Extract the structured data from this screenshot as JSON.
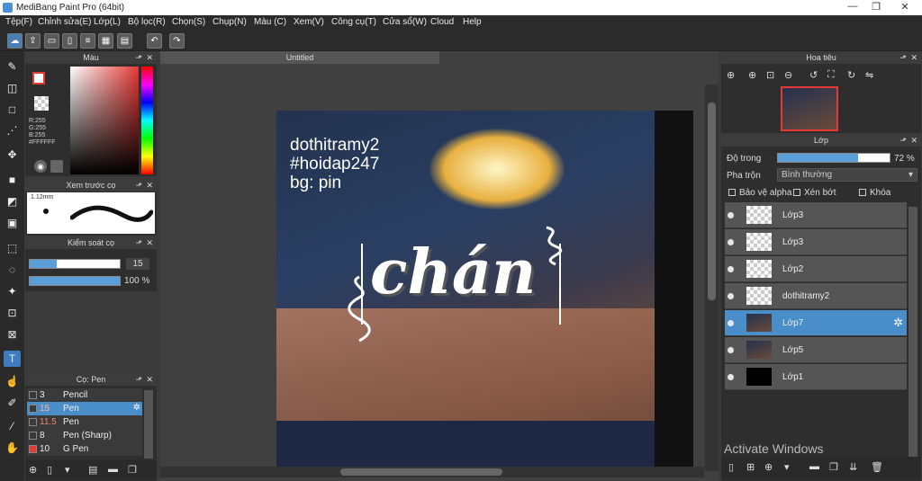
{
  "window": {
    "title": "MediBang Paint Pro (64bit)",
    "min": "—",
    "max": "❐",
    "close": "✕"
  },
  "menu": [
    "Tệp(F)",
    "Chỉnh sửa(E)",
    "Lớp(L)",
    "Bộ lọc(R)",
    "Chọn(S)",
    "Chụp(N)",
    "Màu (C)",
    "Xem(V)",
    "Công cụ(T)",
    "Cửa sổ(W)",
    "Cloud",
    "Help"
  ],
  "panels": {
    "color": {
      "title": "Màu",
      "r": "R:255",
      "g": "G:255",
      "b": "B:255",
      "hex": "#FFFFFF"
    },
    "preview": {
      "title": "Xem trước cọ",
      "size": "1.12mm"
    },
    "brush_control": {
      "title": "Kiểm soát cọ",
      "size_value": "15",
      "size_level": 0.3,
      "opacity_value": "100 %",
      "opacity_level": 1.0
    },
    "brush_list": {
      "title": "Cọ: Pen",
      "items": [
        {
          "size": "3",
          "name": "Pencil",
          "color": "#3a3a3a"
        },
        {
          "size": "15",
          "name": "Pen",
          "color": "#3a3a3a",
          "selected": true
        },
        {
          "size": "11.5",
          "name": "Pen",
          "color": "#3a3a3a"
        },
        {
          "size": "8",
          "name": "Pen (Sharp)",
          "color": "#3a3a3a"
        },
        {
          "size": "10",
          "name": "G Pen",
          "color": "#e53935"
        }
      ]
    }
  },
  "canvas": {
    "tab": "Untitled",
    "text1": "dothitramy2",
    "text2": "#hoidap247",
    "text3": "bg: pin",
    "main_text": "chán"
  },
  "navigator": {
    "title": "Hoa tiêu"
  },
  "layers": {
    "title": "Lớp",
    "opacity_label": "Độ trong",
    "opacity_value": "72 %",
    "opacity_level": 0.72,
    "blend_label": "Pha trộn",
    "blend_value": "Bình thường",
    "protect_alpha": "Bảo vệ alpha",
    "clip": "Xén bớt",
    "lock": "Khóa",
    "items": [
      {
        "name": "Lớp3",
        "thumb": "checker"
      },
      {
        "name": "Lớp3",
        "thumb": "checker"
      },
      {
        "name": "Lớp2",
        "thumb": "checker"
      },
      {
        "name": "dothitramy2",
        "thumb": "checker"
      },
      {
        "name": "Lớp7",
        "thumb": "image",
        "selected": true
      },
      {
        "name": "Lớp5",
        "thumb": "image"
      },
      {
        "name": "Lớp1",
        "thumb": "black"
      }
    ]
  },
  "watermark": "Activate Windows",
  "colors": {
    "accent": "#5b9fd8",
    "selected_row": "#4a8ec9",
    "panel": "#2e2e2e"
  }
}
